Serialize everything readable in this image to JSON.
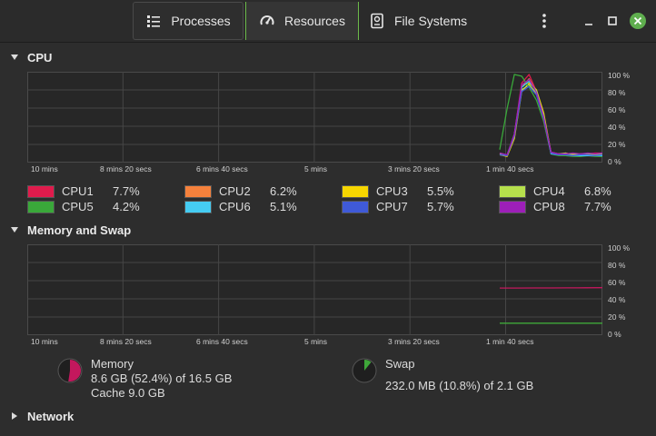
{
  "tabs": [
    {
      "label": "Processes",
      "icon": "list-icon"
    },
    {
      "label": "Resources",
      "icon": "gauge-icon"
    },
    {
      "label": "File Systems",
      "icon": "drive-icon"
    }
  ],
  "sections": {
    "cpu": "CPU",
    "memory": "Memory and Swap",
    "network": "Network"
  },
  "y_ticks": [
    "100 %",
    "80 %",
    "60 %",
    "40 %",
    "20 %",
    "0 %"
  ],
  "x_ticks": [
    "10 mins",
    "8 mins 20 secs",
    "6 mins 40 secs",
    "5 mins",
    "3 mins 20 secs",
    "1 min 40 secs"
  ],
  "cpu_legend": [
    {
      "name": "CPU1",
      "value": "7.7%",
      "color": "#e01b4c"
    },
    {
      "name": "CPU2",
      "value": "6.2%",
      "color": "#f5813c"
    },
    {
      "name": "CPU3",
      "value": "5.5%",
      "color": "#f6d600"
    },
    {
      "name": "CPU4",
      "value": "6.8%",
      "color": "#b6e04c"
    },
    {
      "name": "CPU5",
      "value": "4.2%",
      "color": "#3aa83a"
    },
    {
      "name": "CPU6",
      "value": "5.1%",
      "color": "#45ccf2"
    },
    {
      "name": "CPU7",
      "value": "5.7%",
      "color": "#3f5ad8"
    },
    {
      "name": "CPU8",
      "value": "7.7%",
      "color": "#9d1fb8"
    }
  ],
  "memory": {
    "label": "Memory",
    "usage": "8.6 GB (52.4%) of 16.5 GB",
    "cache": "Cache 9.0 GB",
    "percent": 52.4,
    "color": "#c3185d"
  },
  "swap": {
    "label": "Swap",
    "usage": "232.0 MB (10.8%) of 2.1 GB",
    "percent": 10.8,
    "color": "#3fa83a"
  },
  "chart_data": [
    {
      "type": "line",
      "ylim": [
        0,
        100
      ],
      "y_unit": "%",
      "x_ticks": [
        "10 mins",
        "8 mins 20 secs",
        "6 mins 40 secs",
        "5 mins",
        "3 mins 20 secs",
        "1 min 40 secs"
      ],
      "series": [
        {
          "name": "CPU1",
          "values": [
            8,
            5,
            30,
            90,
            100,
            80,
            45,
            8,
            6,
            8,
            6,
            6,
            7,
            8,
            8
          ]
        },
        {
          "name": "CPU2",
          "values": [
            7,
            5,
            28,
            85,
            95,
            80,
            50,
            9,
            7,
            6,
            7,
            6,
            6,
            5,
            6
          ]
        },
        {
          "name": "CPU3",
          "values": [
            6,
            4,
            25,
            80,
            90,
            82,
            55,
            8,
            6,
            5,
            5,
            6,
            5,
            5,
            5
          ]
        },
        {
          "name": "CPU4",
          "values": [
            7,
            5,
            27,
            82,
            88,
            78,
            52,
            8,
            7,
            8,
            6,
            7,
            7,
            6,
            7
          ]
        },
        {
          "name": "CPU5",
          "values": [
            12,
            60,
            100,
            98,
            85,
            70,
            45,
            7,
            5,
            5,
            4,
            4,
            5,
            4,
            4
          ]
        },
        {
          "name": "CPU6",
          "values": [
            6,
            5,
            30,
            85,
            92,
            80,
            50,
            7,
            6,
            6,
            5,
            5,
            5,
            5,
            5
          ]
        },
        {
          "name": "CPU7",
          "values": [
            6,
            5,
            28,
            80,
            86,
            76,
            48,
            8,
            6,
            6,
            5,
            6,
            6,
            5,
            6
          ]
        },
        {
          "name": "CPU8",
          "values": [
            8,
            6,
            30,
            88,
            94,
            79,
            50,
            9,
            7,
            7,
            8,
            7,
            8,
            7,
            8
          ]
        }
      ]
    },
    {
      "type": "line",
      "ylim": [
        0,
        100
      ],
      "y_unit": "%",
      "x_ticks": [
        "10 mins",
        "8 mins 20 secs",
        "6 mins 40 secs",
        "5 mins",
        "3 mins 20 secs",
        "1 min 40 secs"
      ],
      "series": [
        {
          "name": "Memory",
          "values": [
            52.0,
            52.0,
            52.1,
            52.1,
            52.2,
            52.3,
            52.4
          ]
        },
        {
          "name": "Swap",
          "values": [
            10.8,
            10.8,
            10.8,
            10.8,
            10.8,
            10.8,
            10.8
          ]
        }
      ]
    }
  ]
}
